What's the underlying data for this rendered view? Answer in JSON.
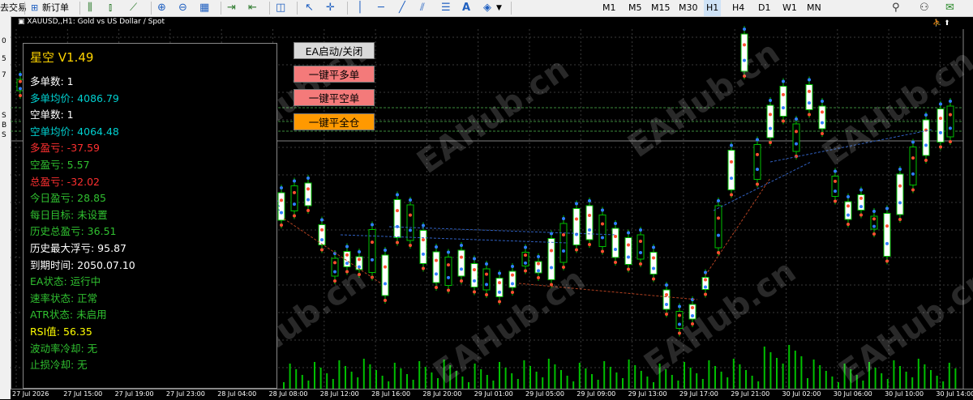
{
  "toolbar": {
    "left_text": "去交易",
    "new_order": "新订单",
    "timeframes": [
      "M1",
      "M5",
      "M15",
      "M30",
      "H1",
      "H4",
      "D1",
      "W1",
      "MN"
    ],
    "active_timeframe": "H1"
  },
  "sidebar_letters": [
    "0",
    "5",
    "7",
    "S",
    "B",
    "S"
  ],
  "chart": {
    "title": "XAUUSD,,H1: Gold vs US Dollar / Spot",
    "colors": {
      "bull": "#00c000",
      "bear": "#00c000",
      "fill_bull": "#ffffff",
      "grid": "#3a3a3a",
      "volume": "#00c000"
    }
  },
  "panel": {
    "title": "星空 V1.49",
    "rows": [
      {
        "label": "多单数: 1",
        "color": "#ffffff"
      },
      {
        "label": "多单均价: 4086.79",
        "color": "#00d0d0"
      },
      {
        "label": "空单数: 1",
        "color": "#ffffff"
      },
      {
        "label": "空单均价: 4064.48",
        "color": "#00d0d0"
      },
      {
        "label": "多盈亏: -37.59",
        "color": "#ff3030"
      },
      {
        "label": "空盈亏: 5.57",
        "color": "#30c030"
      },
      {
        "label": "总盈亏: -32.02",
        "color": "#ff3030"
      },
      {
        "label": "今日盈亏: 28.85",
        "color": "#30c030"
      },
      {
        "label": "每日目标: 未设置",
        "color": "#30c030"
      },
      {
        "label": "历史总盈亏: 36.51",
        "color": "#30c030"
      },
      {
        "label": "历史最大浮亏: 95.87",
        "color": "#ffffff"
      },
      {
        "label": "到期时间: 2050.07.10",
        "color": "#ffffff"
      },
      {
        "label": "EA状态: 运行中",
        "color": "#30c030"
      },
      {
        "label": "速率状态: 正常",
        "color": "#30c030"
      },
      {
        "label": "ATR状态: 未启用",
        "color": "#30c030"
      },
      {
        "label": "RSI值: 56.35",
        "color": "#ffff00"
      },
      {
        "label": "波动率冷却: 无",
        "color": "#30c030"
      },
      {
        "label": "止损冷却: 无",
        "color": "#30c030"
      }
    ]
  },
  "buttons": {
    "ea_toggle": "EA启动/关闭",
    "close_buy": "一键平多单",
    "close_sell": "一键平空单",
    "close_all": "一键平全仓"
  },
  "watermark": "EAHub.cn",
  "x_axis": [
    "27 Jul 2026",
    "27 Jul 15:00",
    "27 Jul 19:00",
    "27 Jul 23:00",
    "28 Jul 04:00",
    "28 Jul 08:00",
    "28 Jul 12:00",
    "28 Jul 16:00",
    "28 Jul 20:00",
    "29 Jul 01:00",
    "29 Jul 05:00",
    "29 Jul 09:00",
    "29 Jul 13:00",
    "29 Jul 17:00",
    "29 Jul 21:00",
    "30 Jul 02:00",
    "30 Jul 06:00",
    "30 Jul 10:00",
    "30 Jul 14:00"
  ]
}
